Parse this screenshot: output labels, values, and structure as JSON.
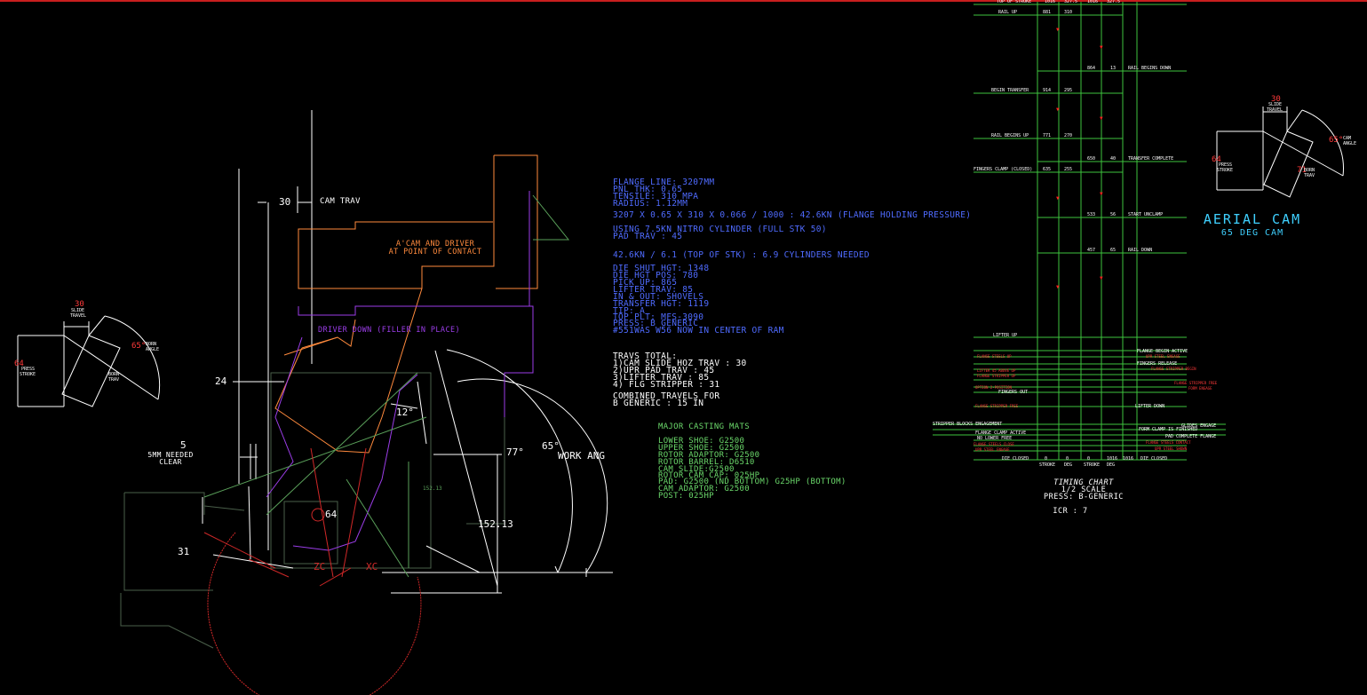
{
  "cam_view": {
    "cam_trav_value": "30",
    "cam_trav_label": "CAM TRAV",
    "contact_note": [
      "A'CAM AND DRIVER",
      "AT POINT OF CONTACT"
    ],
    "driver_down_note": "DRIVER DOWN (FILLER IN PLACE)",
    "dim_24": "24",
    "clear_value": "5",
    "clear_note": [
      "5MM NEEDED",
      "CLEAR"
    ],
    "dim_31": "31",
    "angle_12": "12°",
    "angle_77": "77°",
    "angle_65": "65°",
    "work_ang_label": "WORK ANG",
    "dim_15213": "152.13",
    "dim_15213_small": "152.13",
    "dim_64": "64",
    "zc_label": "ZC",
    "xc_label": "XC"
  },
  "left_inset": {
    "slide_value": "30",
    "slide_label": [
      "SLIDE",
      "TRAVEL"
    ],
    "press_value": "64",
    "press_label": [
      "PRESS",
      "STROKE"
    ],
    "angle_value": "65°",
    "angle_label": [
      "BORN",
      "ANGLE"
    ],
    "inner_label": [
      "BORN",
      "TRAV"
    ]
  },
  "right_inset": {
    "slide_value": "30",
    "slide_label": [
      "SLIDE",
      "TRAVEL"
    ],
    "press_value": "64",
    "press_label": [
      "PRESS",
      "STROKE"
    ],
    "angle_value": "65°",
    "angle_label": [
      "CAM",
      "ANGLE"
    ],
    "inner_value": "71",
    "inner_label": [
      "BORN",
      "TRAV"
    ],
    "title": "AERIAL CAM",
    "subtitle": "65 DEG CAM"
  },
  "notes": {
    "flange_lines": [
      "FLANGE LINE: 3207MM",
      "PNL THK: 0.65",
      "TENSILE: 310 MPA",
      "RADIUS: 1.12MM"
    ],
    "formula": "3207 X 0.65 X 310 X 0.066 / 1000 : 42.6KN (FLANGE HOLDING PRESSURE)",
    "cylinder_lines": [
      "USING 7.5KN NITRO CYLINDER (FULL STK 50)",
      "PAD TRAV : 45"
    ],
    "needed": "42.6KN / 6.1 (TOP OF STK) : 6.9 CYLINDERS NEEDED",
    "die_lines": [
      "DIE SHUT HGT: 1348",
      "DIE HGT POS: 780",
      "PICK UP: 865",
      "LIFTER TRAV: 85",
      "IN & OUT: SHOVELS",
      "TRANSFER HGT: 1119",
      "TIP: A",
      "TOP PLT: MFS-3090",
      "PRESS: B GENERIC",
      "#551WAS W56 NOW IN CENTER OF RAM"
    ],
    "travs_lines": [
      "TRAVS TOTAL:",
      "1)CAM SLIDE HOZ TRAV : 30",
      "2)UPR PAD TRAV : 45",
      "3)LIFTER TRAV : 85",
      "4) FLG STRIPPER : 31"
    ],
    "combined_lines": [
      "COMBINED TRAVELS FOR",
      "B GENERIC : 15 IN"
    ],
    "castings_title": "MAJOR CASTING MATS",
    "castings_lines": [
      "LOWER SHOE: G2500",
      "UPPER SHOE: G2500",
      "ROTOR ADAPTOR: G2500",
      "ROTOR BARREL: D6510",
      "CAM SLIDE:G2500",
      "ROTOR CAM CAP: 025HP",
      "PAD: G2500 (ND BOTTOM) G25HP (BOTTOM)",
      "CAM ADAPTOR: G2500",
      "POST: 025HP"
    ]
  },
  "timing": {
    "header": [
      "TOP OF STROKE",
      "1016",
      "327.5",
      "1016",
      "327.5"
    ],
    "rows_left": [
      {
        "label": "RAIL UP",
        "a": "881",
        "b": "310"
      },
      {
        "label": "BEGIN TRANSFER",
        "a": "914",
        "b": "295"
      },
      {
        "label": "RAIL BEGINS UP",
        "a": "771",
        "b": "270"
      },
      {
        "label": "FINGERS CLAMP (CLOSED)",
        "a": "635",
        "b": "255"
      }
    ],
    "rows_right": [
      {
        "a": "864",
        "b": "13",
        "label": "RAIL BEGINS DOWN"
      },
      {
        "a": "650",
        "b": "40",
        "label": "TRANSFER COMPLETE"
      },
      {
        "a": "533",
        "b": "56",
        "label": "START UNCLAMP"
      },
      {
        "a": "457",
        "b": "65",
        "label": "RAIL DOWN"
      }
    ],
    "lower_left": [
      "LIFTER UP",
      "FLANGE STEELS UP",
      "LIFTER 45 ABOVE UP",
      "FLANGE STRIPPER UP",
      "OPTION 2-POSITION",
      "FINGERS OUT",
      "FLANGE STRIPPER FREE",
      "STRIPPER BLOCKS ENGAGEMENT",
      "FLANGE CLAMP ACTIVE",
      "NO LOWER FREE",
      "FLANGE STEELS CLOSE",
      "UPR STEEL ENGAGE"
    ],
    "lower_right": [
      "FLANGE BEGIN ACTIVE",
      "UPR STEEL ENGAGE",
      "FINGERS RELEASE",
      "FLANGE STRIPPER BEGIN",
      "FLANGE STRIPPER FREE",
      "FORM ENGAGE",
      "LIFTER DOWN",
      "GLIDES ENGAGE",
      "FORM CLAMP IS FINISHED",
      "PAD COMPLETE FLANGE",
      "FLANGE STEELS CONTACT",
      "UPR STEEL SHOWN",
      "DIE CLOSED"
    ],
    "footer_left": [
      "DIE CLOSED",
      "0",
      "0"
    ],
    "footer_right": [
      "0",
      "1016",
      "1016"
    ],
    "stroke_labels": [
      "STROKE",
      "DEG",
      "STROKE",
      "DEG"
    ],
    "foot": [
      "TIMING CHART",
      "1/2 SCALE",
      "PRESS: B-GENERIC"
    ],
    "icr": "ICR : 7"
  }
}
